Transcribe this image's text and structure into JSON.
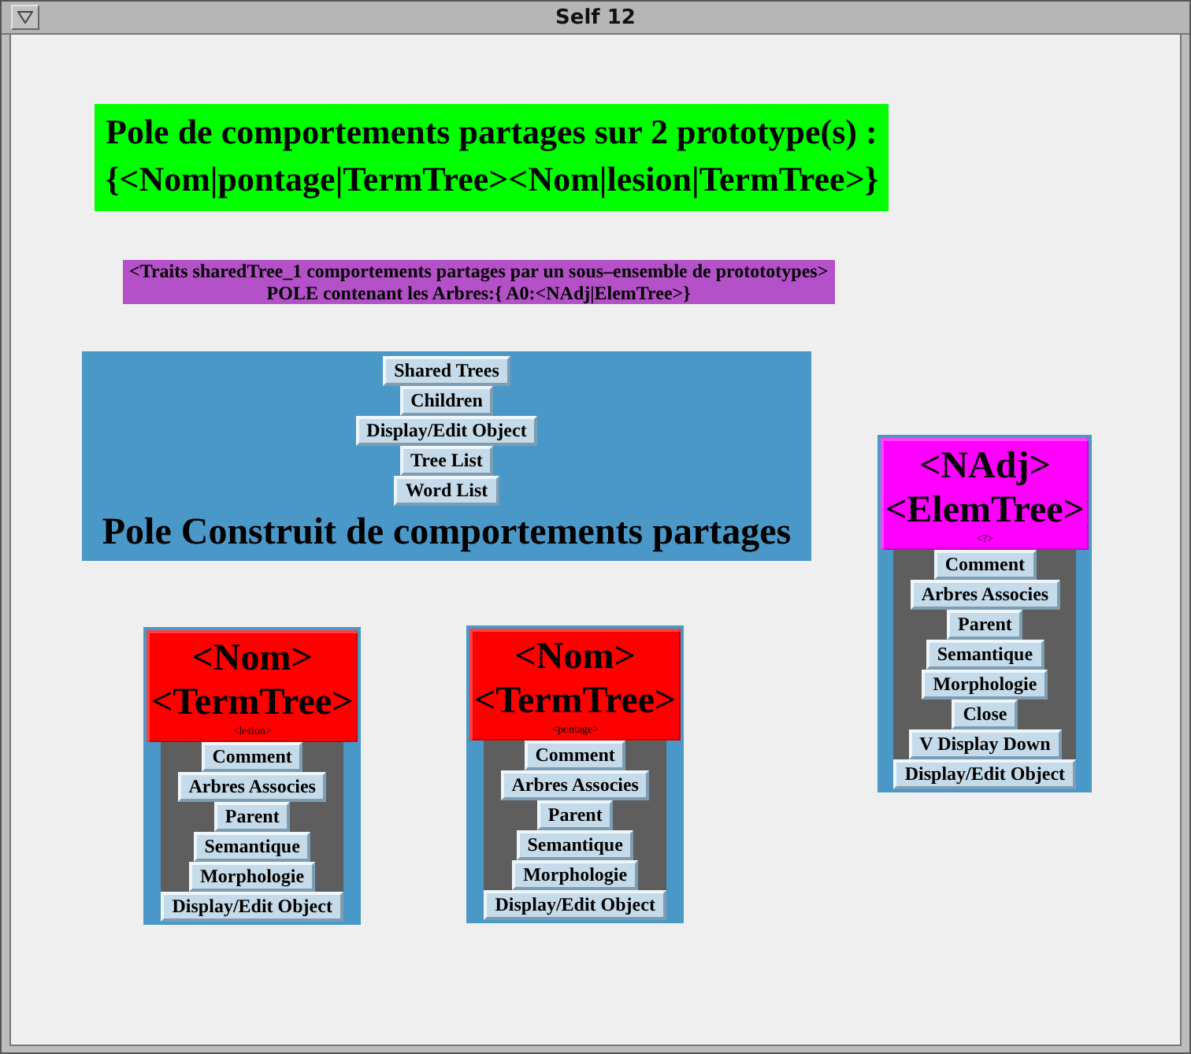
{
  "window": {
    "title": "Self 12"
  },
  "banner": {
    "lines": [
      "Pole de comportements partages sur 2 prototype(s) :",
      "{<Nom|pontage|TermTree><Nom|lesion|TermTree>}"
    ]
  },
  "traits": {
    "lines": [
      "<Traits sharedTree_1 comportements partages par un sous–ensemble de protototypes>",
      "POLE contenant les Arbres:{ A0:<NAdj|ElemTree>}"
    ]
  },
  "pole": {
    "buttons": [
      "Shared Trees",
      "Children",
      "Display/Edit Object",
      "Tree List",
      "Word List"
    ],
    "title": "Pole Construit de comportements partages"
  },
  "trees": [
    {
      "category": "<NAdj>",
      "tree_type": "<ElemTree>",
      "word": "<?>",
      "color": "#ff00ff",
      "buttons": [
        "Comment",
        "Arbres Associes",
        "Parent",
        "Semantique",
        "Morphologie",
        "Close",
        "V Display Down",
        "Display/Edit Object"
      ]
    },
    {
      "category": "<Nom>",
      "tree_type": "<TermTree>",
      "word": "<lesion>",
      "color": "#ff0000",
      "buttons": [
        "Comment",
        "Arbres Associes",
        "Parent",
        "Semantique",
        "Morphologie",
        "Display/Edit Object"
      ]
    },
    {
      "category": "<Nom>",
      "tree_type": "<TermTree>",
      "word": "<pontage>",
      "color": "#ff0000",
      "buttons": [
        "Comment",
        "Arbres Associes",
        "Parent",
        "Semantique",
        "Morphologie",
        "Display/Edit Object"
      ]
    }
  ]
}
